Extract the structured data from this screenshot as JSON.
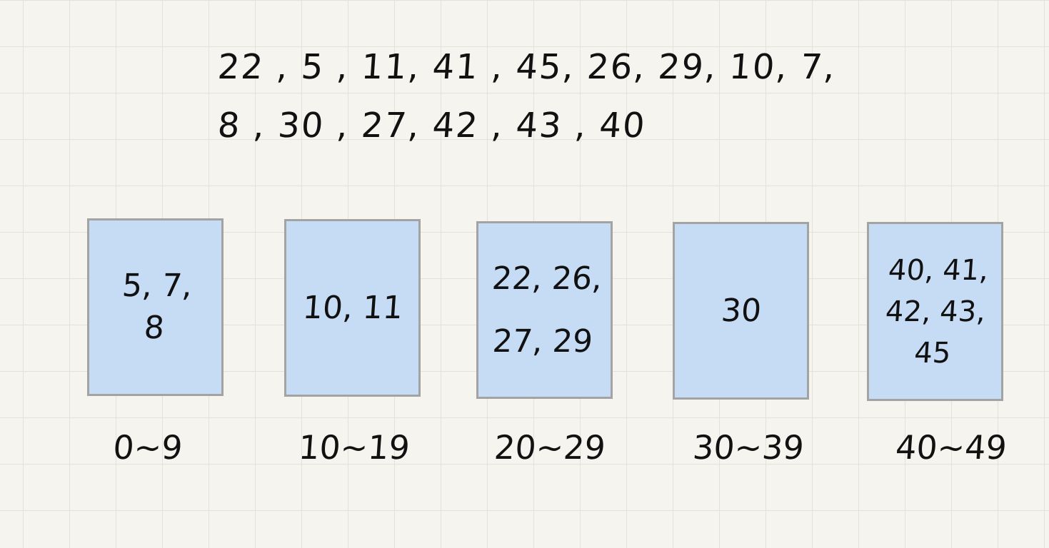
{
  "sequence": {
    "line1": "22 , 5 , 11, 41 , 45, 26, 29, 10, 7,",
    "line2": "8 , 30 , 27, 42 , 43 , 40"
  },
  "buckets": [
    {
      "contents": "5, 7,\n8",
      "range": "0~9"
    },
    {
      "contents": "10, 11",
      "range": "10~19"
    },
    {
      "contents": "22, 26,\n27, 29",
      "range": "20~29"
    },
    {
      "contents": "30",
      "range": "30~39"
    },
    {
      "contents": "40, 41,\n42, 43,\n45",
      "range": "40~49"
    }
  ],
  "colors": {
    "background": "#f5f4ee",
    "grid_line": "#e2e2da",
    "bucket_fill": "#c5dcf4",
    "bucket_border": "#a3a3a3",
    "ink": "#111111"
  }
}
